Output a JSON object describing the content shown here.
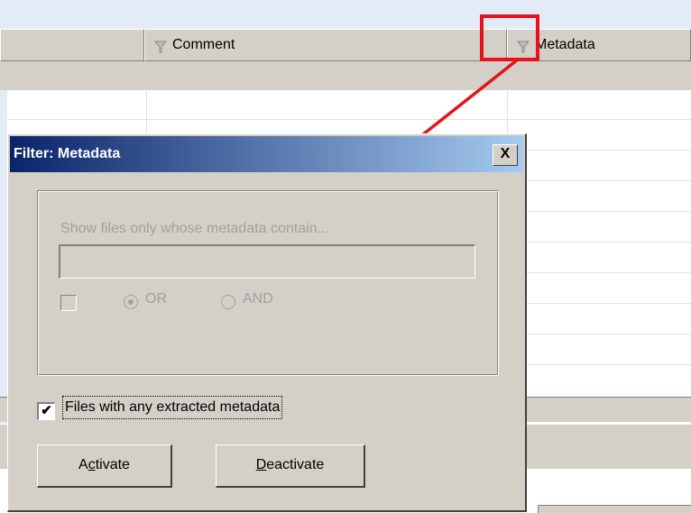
{
  "columns": [
    {
      "label": "Comment"
    },
    {
      "label": "Metadata"
    }
  ],
  "dialog": {
    "title": "Filter: Metadata",
    "close_label": "X",
    "prompt": "Show files only whose metadata contain...",
    "search_value": "",
    "radio_or_label": "OR",
    "radio_and_label": "AND",
    "radio_selected": "OR",
    "extracted_checkbox_checked": true,
    "extracted_checkbox_label": "Files with any extracted metadata",
    "activate_button": {
      "prefix": "A",
      "accel": "c",
      "rest": "tivate"
    },
    "deactivate_button": {
      "prefix": "",
      "accel": "D",
      "rest": "eactivate"
    }
  },
  "annotation_color": "#e8121a"
}
